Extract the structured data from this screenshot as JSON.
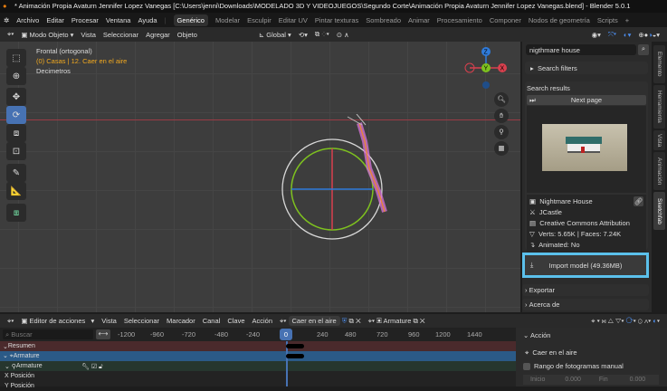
{
  "title": "* Animación Propia Avaturn Jennifer Lopez Vanegas [C:\\Users\\jenni\\Downloads\\MODELADO 3D Y VIDEOJUEGOS\\Segundo Corte\\Animación Propia Avaturn Jennifer Lopez Vanegas.blend] - Blender 5.0.1",
  "menu": [
    "Archivo",
    "Editar",
    "Procesar",
    "Ventana",
    "Ayuda"
  ],
  "workspaces": [
    "Genérico",
    "Modelar",
    "Esculpir",
    "Editar UV",
    "Pintar texturas",
    "Sombreado",
    "Animar",
    "Procesamiento",
    "Componer",
    "Nodos de geometría",
    "Scripts"
  ],
  "workspace_add": "+",
  "viewport_header": {
    "mode": "Modo Objeto",
    "menus": [
      "Vista",
      "Seleccionar",
      "Agregar",
      "Objeto"
    ],
    "orientation": "Global"
  },
  "overlay": {
    "view": "Frontal (ortogonal)",
    "collection": "(0) Casas | 12. Caer en el aire",
    "units": "Decimetros"
  },
  "gizmo": {
    "z": "Z",
    "y": "Y",
    "x": "X"
  },
  "sketchfab": {
    "search_value": "nigthmare house",
    "search_filters": "Search filters",
    "results_label": "Search results",
    "next_page": "Next page",
    "model_name": "Nightmare House",
    "author": "JCastle",
    "license": "Creative Commons Attribution",
    "verts_faces": "Verts: 5.65K  |  Faces: 7.24K",
    "animated": "Animated: No",
    "import_button": "Import model (49.36MB)",
    "exportar": "Exportar",
    "acerca": "Acerca de",
    "highlight_color": "#5bc0eb"
  },
  "side_tabs": [
    "Elemento",
    "Herramienta",
    "Vista",
    "Animación",
    "Sketchfab"
  ],
  "timeline_header": {
    "editor": "Editor de acciones",
    "menus": [
      "Vista",
      "Seleccionar",
      "Marcador",
      "Canal",
      "Clave",
      "Acción"
    ],
    "action": "Caer en el aire",
    "object": "Armature"
  },
  "search_placeholder": "Buscar",
  "ruler": [
    "-1200",
    "-960",
    "-720",
    "-480",
    "-240",
    "0",
    "240",
    "480",
    "720",
    "960",
    "1200",
    "1440"
  ],
  "current_frame": "0",
  "channels": [
    "Resumen",
    "Armature",
    "Armature",
    "X Posición",
    "Y Posición"
  ],
  "action_panel": {
    "title": "Acción",
    "action": "Caer en el aire",
    "manual_range": "Rango de fotogramas manual",
    "inicio_label": "Inicio",
    "inicio": "0.000",
    "fin_label": "Fin",
    "fin": "0.000"
  }
}
